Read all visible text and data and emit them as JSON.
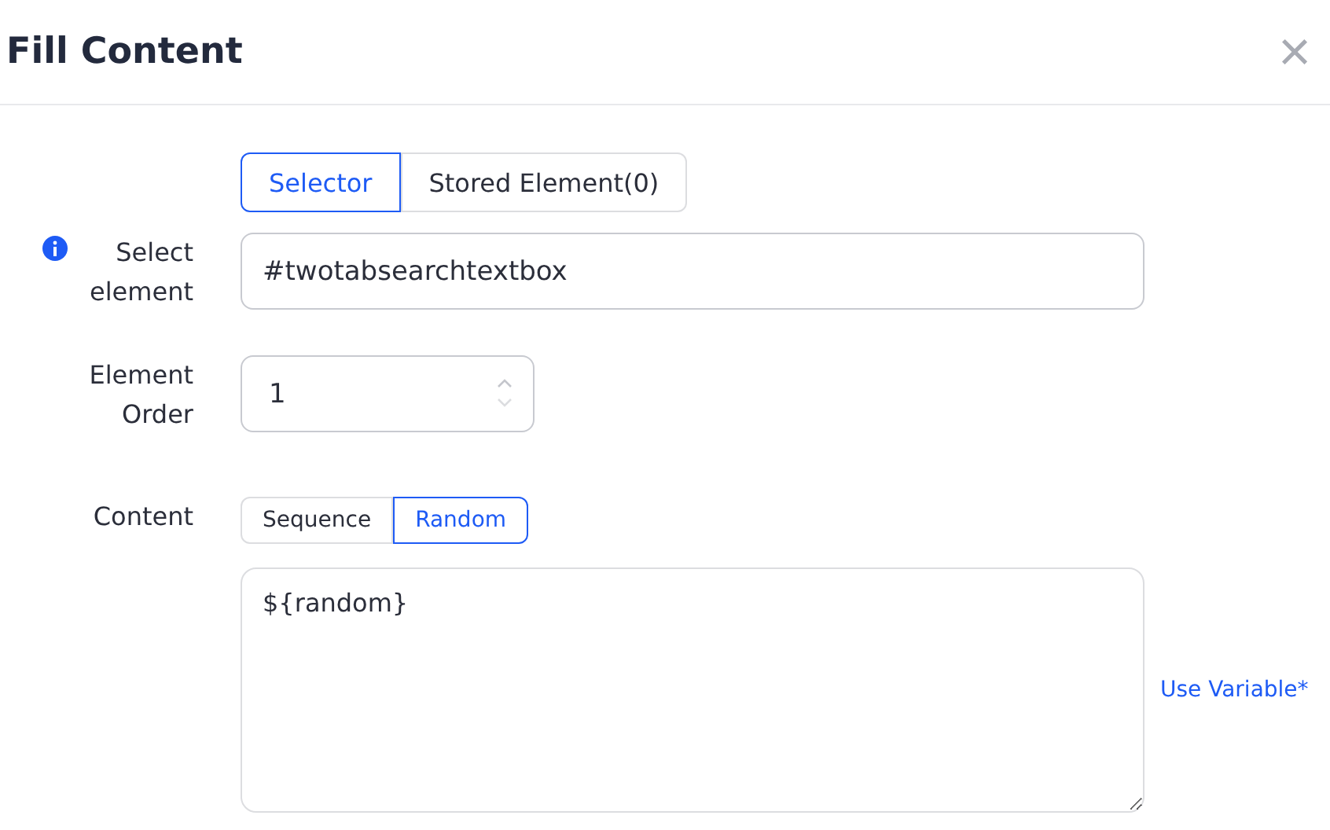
{
  "dialog": {
    "title": "Fill Content",
    "close": "×"
  },
  "source_tabs": [
    {
      "label": "Selector",
      "selected": true
    },
    {
      "label": "Stored Element(0)",
      "selected": false
    }
  ],
  "select_element": {
    "label": "Select element",
    "value": "#twotabsearchtextbox"
  },
  "element_order": {
    "label": "Element Order",
    "value": "1"
  },
  "content": {
    "label": "Content",
    "modes": [
      {
        "label": "Sequence",
        "selected": false
      },
      {
        "label": "Random",
        "selected": true
      }
    ],
    "value": "${random}",
    "link": "Use Variable*"
  }
}
